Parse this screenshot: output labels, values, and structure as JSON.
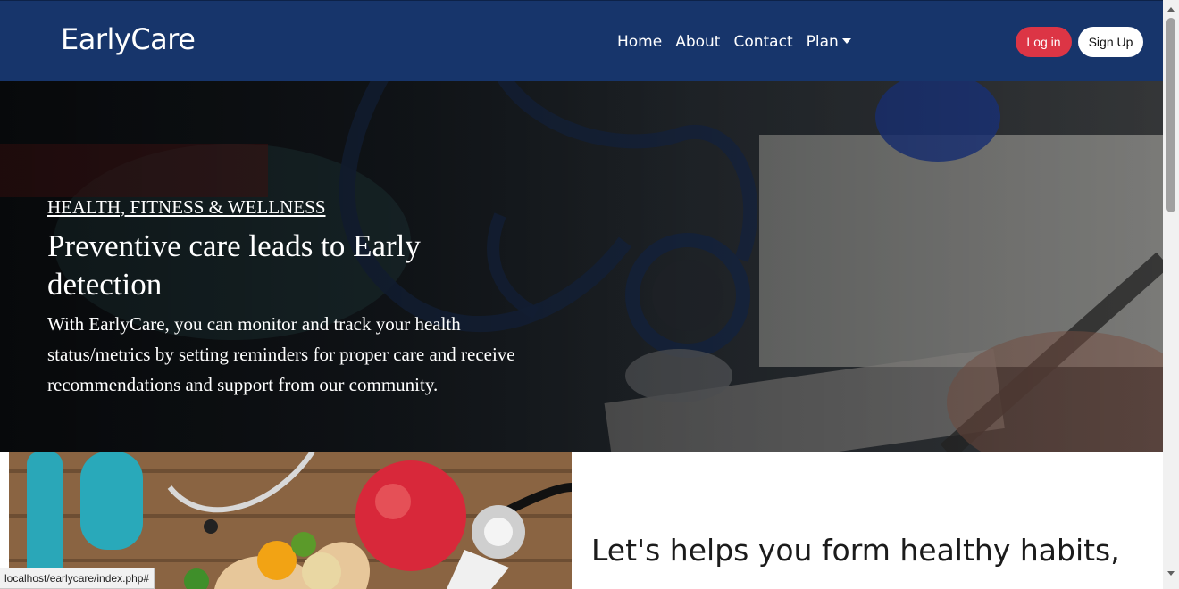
{
  "navbar": {
    "brand": "EarlyCare",
    "links": [
      "Home",
      "About",
      "Contact",
      "Plan"
    ],
    "login_label": "Log in",
    "signup_label": "Sign Up",
    "colors": {
      "background": "#17356b",
      "login": "#dc3545",
      "signup": "#ffffff"
    }
  },
  "hero": {
    "eyebrow": "HEALTH, FITNESS & WELLNESS",
    "title": "Preventive care leads to Early detection",
    "text": "With EarlyCare, you can monitor and track your health status/metrics by setting reminders for proper care and receive recommendations and support from our community."
  },
  "section": {
    "heading": "Let's helps you form healthy habits,"
  },
  "status_bar": {
    "url": "localhost/earlycare/index.php#"
  },
  "icons": {
    "plan_dropdown": "chevron-down-icon"
  }
}
